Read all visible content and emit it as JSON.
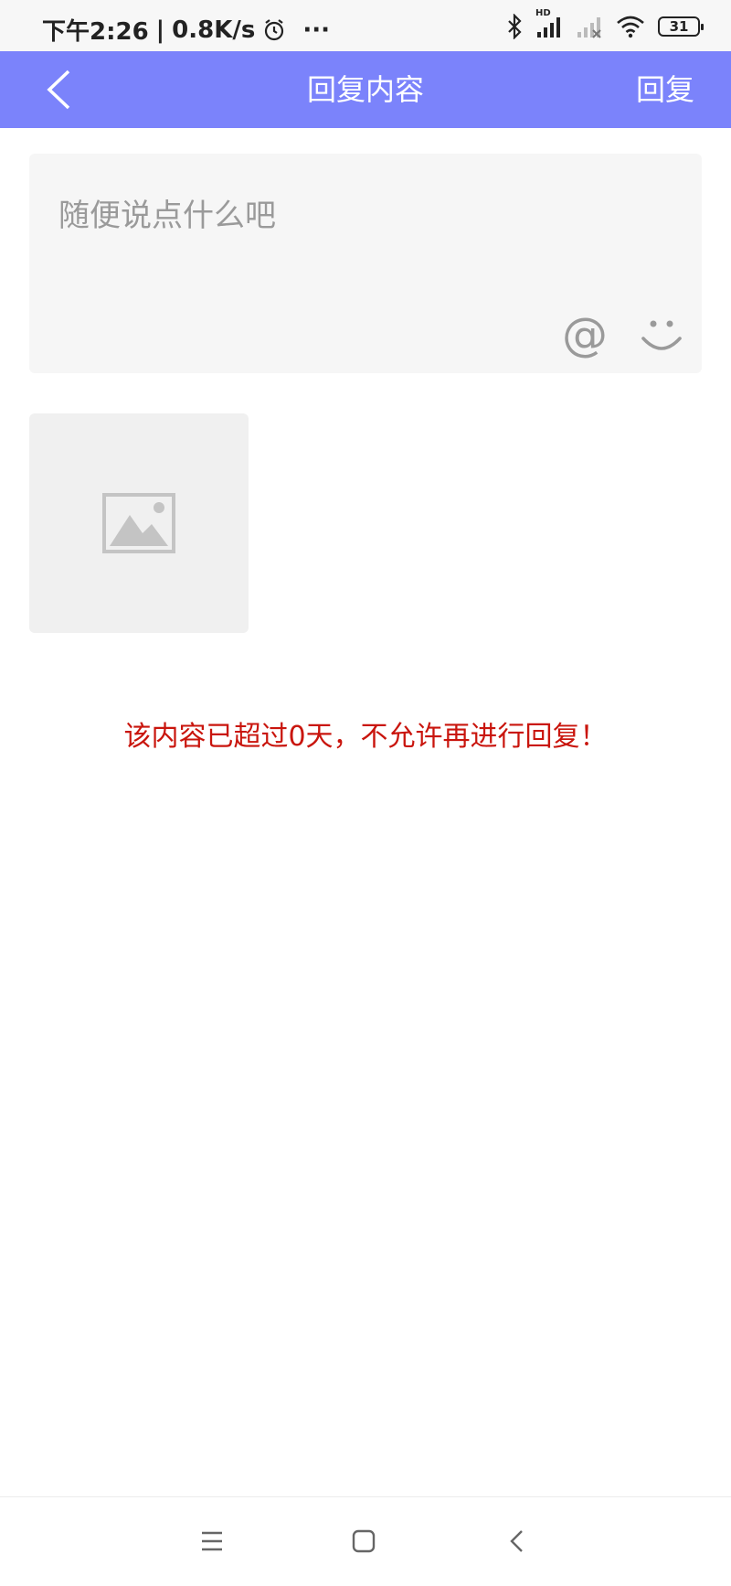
{
  "status_bar": {
    "time": "下午2:26",
    "network_speed": "0.8K/s",
    "alarm_icon": "alarm-icon",
    "more": "···",
    "bluetooth_icon": "bluetooth-icon",
    "signal_label": "HD",
    "wifi_icon": "wifi-icon",
    "battery_level": "31"
  },
  "header": {
    "title": "回复内容",
    "reply_button": "回复",
    "back_icon": "back-arrow-icon",
    "background_color": "#7b83fb"
  },
  "composer": {
    "placeholder": "随便说点什么吧",
    "value": "",
    "mention_icon": "@",
    "emoji_icon": "smile-icon"
  },
  "attachment": {
    "icon": "image-placeholder-icon"
  },
  "notice": {
    "text": "该内容已超过0天，不允许再进行回复！",
    "color": "#c9150d"
  },
  "system_nav": {
    "menu_icon": "menu-icon",
    "home_icon": "home-icon",
    "back_icon": "back-icon"
  }
}
